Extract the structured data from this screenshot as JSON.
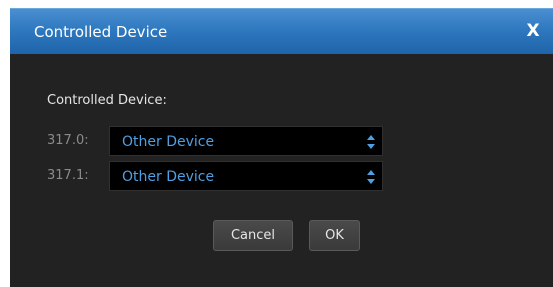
{
  "dialog": {
    "title": "Controlled Device",
    "close_label": "X"
  },
  "form": {
    "section_label": "Controlled Device:",
    "rows": [
      {
        "label": "317.0:",
        "value": "Other Device",
        "icon": "select-arrows-icon"
      },
      {
        "label": "317.1:",
        "value": "Other Device",
        "icon": "select-arrows-icon"
      }
    ]
  },
  "buttons": {
    "cancel_label": "Cancel",
    "ok_label": "OK"
  },
  "colors": {
    "titlebar": "#2f79c0",
    "dialog_bg": "#222222",
    "select_bg": "#000000",
    "select_text": "#4f9fe3",
    "row_label": "#8a8a8a"
  }
}
